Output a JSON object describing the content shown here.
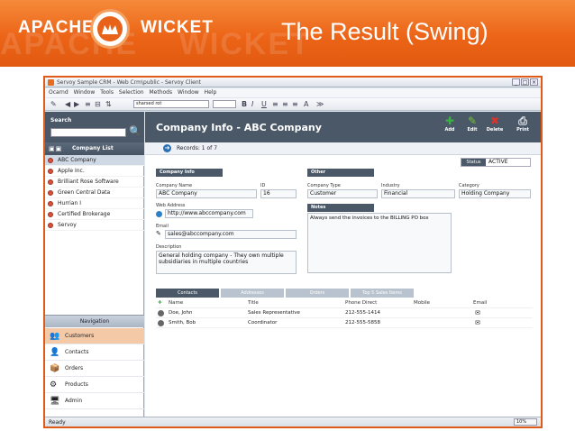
{
  "slide": {
    "title": "The Result (Swing)",
    "logo_left": "APACHE",
    "logo_right": "WICKET"
  },
  "window": {
    "title": "Servoy Sample CRM - Web Crm\\public - Servoy Client",
    "controls": [
      "_",
      "□",
      "×"
    ]
  },
  "menu": [
    "Ocarnd",
    "Window",
    "Tools",
    "Selection",
    "Methods",
    "Window",
    "Help"
  ],
  "toolbar": {
    "font_select": "sharsed rot",
    "size_select": "",
    "format_buttons": [
      "B",
      "I",
      "U",
      "≡",
      "≡",
      "≡",
      "A",
      "≫"
    ]
  },
  "search": {
    "label": "Search",
    "value": ""
  },
  "company_list": {
    "header": "Company List",
    "items": [
      {
        "name": "ABC Company",
        "selected": true
      },
      {
        "name": "Apple Inc.",
        "selected": false
      },
      {
        "name": "Brilliant Rose Software",
        "selected": false
      },
      {
        "name": "Green Central Data",
        "selected": false
      },
      {
        "name": "Hurrian I",
        "selected": false
      },
      {
        "name": "Certified Brokerage",
        "selected": false
      },
      {
        "name": "Servoy",
        "selected": false
      }
    ]
  },
  "navigation": {
    "header": "Navigation",
    "items": [
      {
        "label": "Customers",
        "icon": "customers-icon",
        "selected": true
      },
      {
        "label": "Contacts",
        "icon": "contacts-icon",
        "selected": false
      },
      {
        "label": "Orders",
        "icon": "orders-icon",
        "selected": false
      },
      {
        "label": "Products",
        "icon": "products-icon",
        "selected": false
      },
      {
        "label": "Admin",
        "icon": "admin-icon",
        "selected": false
      }
    ]
  },
  "main": {
    "title": "Company Info - ABC Company",
    "actions": [
      {
        "label": "Add",
        "icon": "add-icon",
        "color": "#3cb043"
      },
      {
        "label": "Edit",
        "icon": "edit-icon",
        "color": "#7bbf3a"
      },
      {
        "label": "Delete",
        "icon": "delete-icon",
        "color": "#d9342b"
      },
      {
        "label": "Print",
        "icon": "print-icon",
        "color": "#e6e9ee"
      }
    ],
    "records": "Records: 1 of 7",
    "status_label": "Status",
    "status_value": "ACTIVE",
    "company_info_header": "Company Info",
    "other_header": "Other",
    "notes_header": "Notes",
    "fields": {
      "company_name_label": "Company Name",
      "company_name": "ABC Company",
      "id_label": "ID",
      "id": "16",
      "web_label": "Web Address",
      "web": "http://www.abccompany.com",
      "email_label": "Email",
      "email": "sales@abccompany.com",
      "description_label": "Description",
      "description": "General holding company - They own multiple subsidiaries in multiple countries",
      "company_type_label": "Company Type",
      "company_type": "Customer",
      "industry_label": "Industry",
      "industry": "Financial",
      "category_label": "Category",
      "category": "Holding Company",
      "notes": "Always send the invoices to the BILLING PO box"
    },
    "tabs": [
      {
        "label": "Contacts",
        "active": true
      },
      {
        "label": "Addresses",
        "active": false
      },
      {
        "label": "Orders",
        "active": false
      },
      {
        "label": "Top 5 Sales Items",
        "active": false
      }
    ],
    "contacts": {
      "headers": [
        "Name",
        "Title",
        "Phone Direct",
        "Mobile",
        "Email"
      ],
      "rows": [
        {
          "name": "Doe, John",
          "title": "Sales Representative",
          "phone": "212-555-1414",
          "mobile": ""
        },
        {
          "name": "Smith, Bob",
          "title": "Coordinator",
          "phone": "212-555-5858",
          "mobile": ""
        }
      ]
    }
  },
  "statusbar": {
    "text": "Ready",
    "zoom": "10%"
  }
}
